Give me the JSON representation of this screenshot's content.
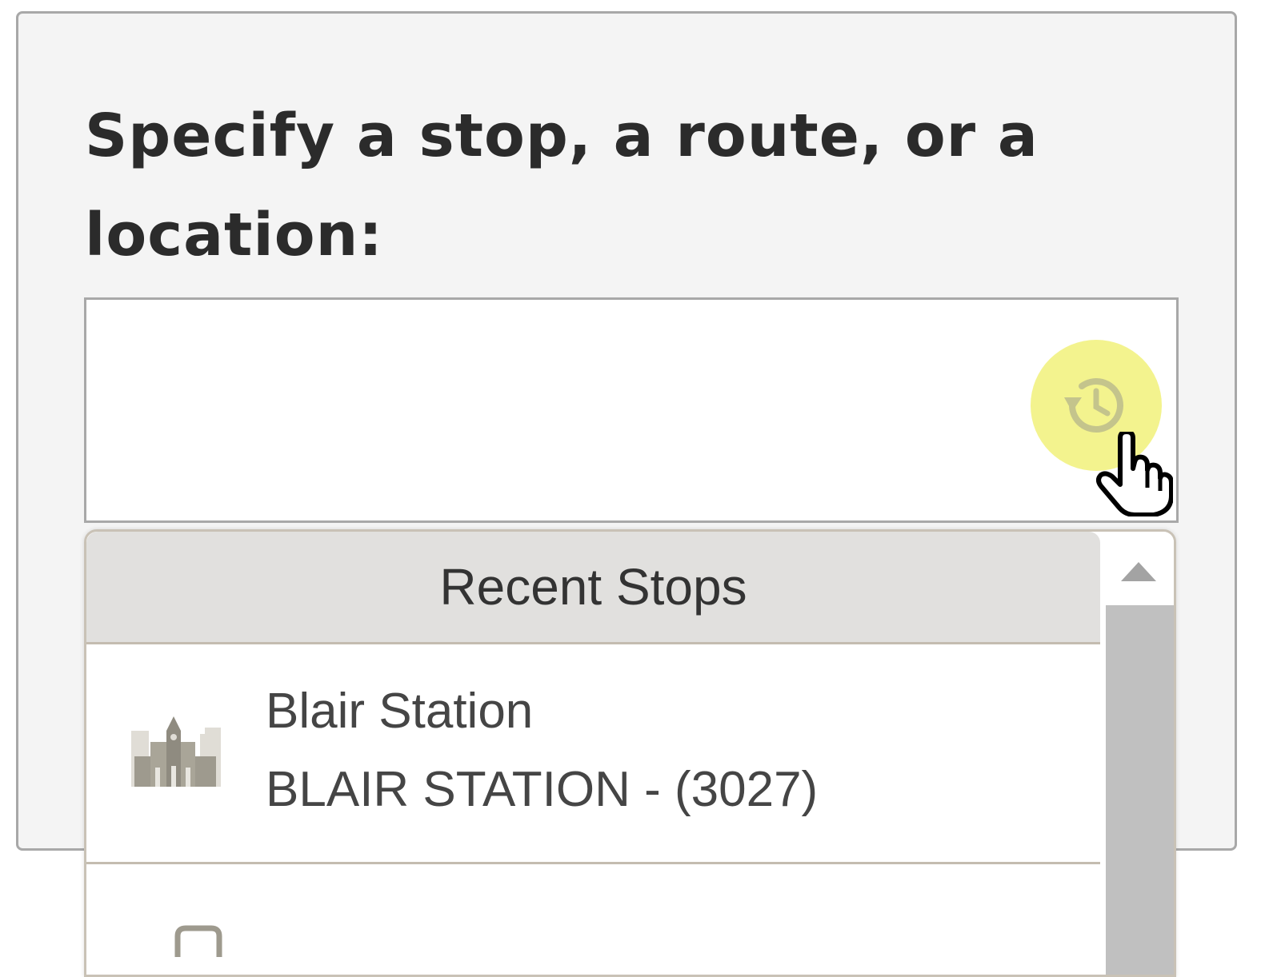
{
  "panel": {
    "title": "Specify a stop, a route, or a location:"
  },
  "search": {
    "value": "",
    "placeholder": "",
    "history_button_icon": "history-icon"
  },
  "dropdown": {
    "header": "Recent Stops",
    "items": [
      {
        "icon": "station-building-icon",
        "name": "Blair Station",
        "code": "BLAIR STATION - (3027)"
      }
    ]
  },
  "colors": {
    "panel_bg": "#f4f4f4",
    "highlight": "#f0f06e",
    "header_bg": "#e1e0de",
    "icon_tone": "#9e9a8e"
  }
}
